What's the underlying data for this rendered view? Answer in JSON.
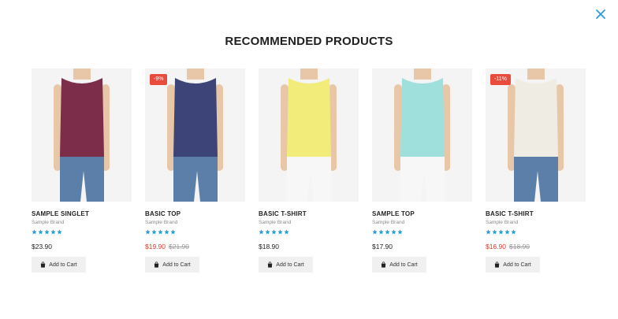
{
  "modal": {
    "title": "RECOMMENDED PRODUCTS",
    "close_icon": "close-icon"
  },
  "colors": {
    "accent": "#2e9bd6",
    "sale": "#e03a2e",
    "badge": "#e74c3c"
  },
  "products": [
    {
      "name": "SAMPLE SINGLET",
      "brand": "Sample Brand",
      "rating": 5,
      "price": "$23.90",
      "old_price": "",
      "badge": "",
      "on_sale": false,
      "cart_label": "Add to Cart",
      "top_color": "#7b2d4a",
      "bottom_color": "#5b7fa8"
    },
    {
      "name": "BASIC TOP",
      "brand": "Sample Brand",
      "rating": 5,
      "price": "$19.90",
      "old_price": "$21.90",
      "badge": "-9%",
      "on_sale": true,
      "cart_label": "Add to Cart",
      "top_color": "#3d4478",
      "bottom_color": "#5b7fa8"
    },
    {
      "name": "BASIC T-SHIRT",
      "brand": "Sample Brand",
      "rating": 5,
      "price": "$18.90",
      "old_price": "",
      "badge": "",
      "on_sale": false,
      "cart_label": "Add to Cart",
      "top_color": "#f2ec7a",
      "bottom_color": "#f7f7f7"
    },
    {
      "name": "SAMPLE TOP",
      "brand": "Sample Brand",
      "rating": 5,
      "price": "$17.90",
      "old_price": "",
      "badge": "",
      "on_sale": false,
      "cart_label": "Add to Cart",
      "top_color": "#9fe0dc",
      "bottom_color": "#f7f7f7"
    },
    {
      "name": "BASIC T-SHIRT",
      "brand": "Sample Brand",
      "rating": 5,
      "price": "$16.90",
      "old_price": "$18.90",
      "badge": "-11%",
      "on_sale": true,
      "cart_label": "Add to Cart",
      "top_color": "#efece4",
      "bottom_color": "#5b7fa8"
    }
  ]
}
